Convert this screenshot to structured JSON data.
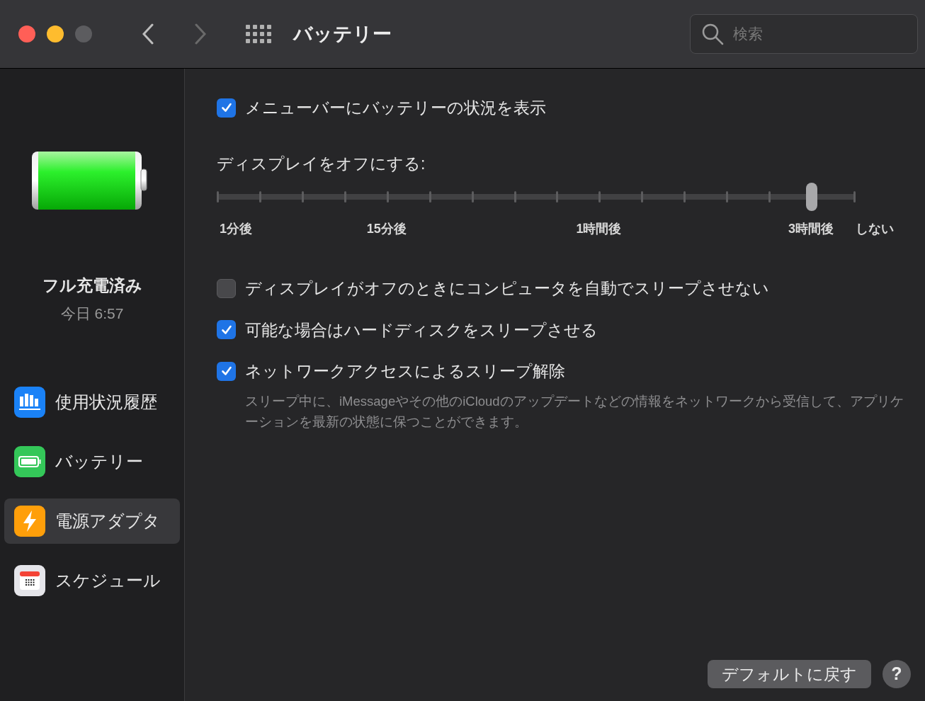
{
  "window": {
    "title": "バッテリー"
  },
  "search": {
    "placeholder": "検索"
  },
  "battery": {
    "status": "フル充電済み",
    "time": "今日 6:57"
  },
  "sidebar": {
    "items": [
      {
        "kind": "usage",
        "label": "使用状況履歴",
        "selected": false
      },
      {
        "kind": "battery",
        "label": "バッテリー",
        "selected": false
      },
      {
        "kind": "power",
        "label": "電源アダプタ",
        "selected": true
      },
      {
        "kind": "schedule",
        "label": "スケジュール",
        "selected": false
      }
    ]
  },
  "options": [
    {
      "kind": "checkbox",
      "label": "メニューバーにバッテリーの状況を表示",
      "checked": true
    },
    {
      "kind": "slider",
      "label": "ディスプレイをオフにする:",
      "level": 0.9333,
      "tick_labels": [
        "1分後",
        "15分後",
        "1時間後",
        "3時間後",
        "しない"
      ]
    },
    {
      "kind": "checkbox",
      "label": "ディスプレイがオフのときにコンピュータを自動でスリープさせない",
      "checked": false
    },
    {
      "kind": "checkbox",
      "label": "可能な場合はハードディスクをスリープさせる",
      "checked": true
    },
    {
      "kind": "checkbox",
      "label": "ネットワークアクセスによるスリープ解除",
      "checked": true,
      "description": "スリープ中に、iMessageやその他のiCloudのアップデートなどの情報をネットワークから受信して、アプリケーションを最新の状態に保つことができます。"
    }
  ],
  "buttons": [
    {
      "kind": "default",
      "label": "デフォルトに戻す"
    },
    {
      "kind": "help",
      "label": "?"
    }
  ]
}
